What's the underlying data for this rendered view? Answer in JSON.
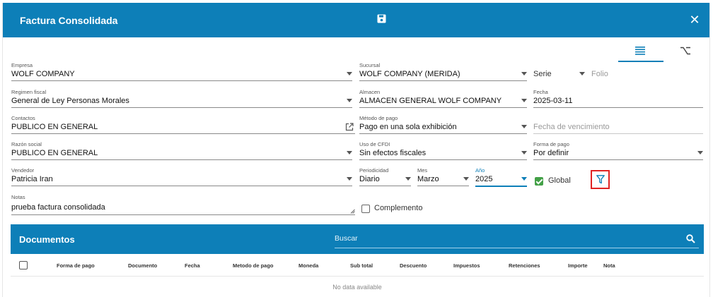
{
  "window": {
    "title": "Factura Consolidada"
  },
  "form": {
    "empresa": {
      "label": "Empresa",
      "value": "WOLF COMPANY"
    },
    "sucursal": {
      "label": "Sucursal",
      "value": "WOLF COMPANY (MERIDA)"
    },
    "serie": {
      "placeholder": "Serie"
    },
    "folio": {
      "placeholder": "Folio"
    },
    "regimen_fiscal": {
      "label": "Regimen fiscal",
      "value": "General de Ley Personas Morales"
    },
    "almacen": {
      "label": "Almacen",
      "value": "ALMACEN GENERAL WOLF COMPANY"
    },
    "fecha": {
      "label": "Fecha",
      "value": "2025-03-11"
    },
    "contactos": {
      "label": "Contactos",
      "value": "PUBLICO EN GENERAL"
    },
    "metodo_pago": {
      "label": "Método de pago",
      "value": "Pago en una sola exhibición"
    },
    "fecha_vencimiento": {
      "placeholder": "Fecha de vencimiento"
    },
    "razon_social": {
      "label": "Razón social",
      "value": "PUBLICO EN GENERAL"
    },
    "uso_cfdi": {
      "label": "Uso de CFDI",
      "value": "Sin efectos fiscales"
    },
    "forma_pago": {
      "label": "Forma de pago",
      "value": "Por definir"
    },
    "vendedor": {
      "label": "Vendedor",
      "value": "Patricia Iran"
    },
    "periodicidad": {
      "label": "Periodicidad",
      "value": "Diario"
    },
    "mes": {
      "label": "Mes",
      "value": "Marzo"
    },
    "anio": {
      "label": "Año",
      "value": "2025"
    },
    "global": {
      "label": "Global",
      "checked": true
    },
    "notas": {
      "label": "Notas",
      "value": "prueba factura consolidada"
    },
    "complemento": {
      "label": "Complemento",
      "checked": false
    }
  },
  "documentos": {
    "title": "Documentos",
    "search_placeholder": "Buscar",
    "columns": [
      "Forma de pago",
      "Documento",
      "Fecha",
      "Metodo de pago",
      "Moneda",
      "Sub total",
      "Descuento",
      "Impuestos",
      "Retenciones",
      "Importe",
      "Nota"
    ],
    "empty_text": "No data available"
  },
  "colors": {
    "primary": "#0d7fb8",
    "check": "#43a047",
    "highlight": "#e02424"
  },
  "icons": [
    "save-icon",
    "close-icon",
    "list-view-icon",
    "alt-view-icon",
    "external-link-icon",
    "filter-icon",
    "search-icon",
    "textarea-resize-icon"
  ]
}
